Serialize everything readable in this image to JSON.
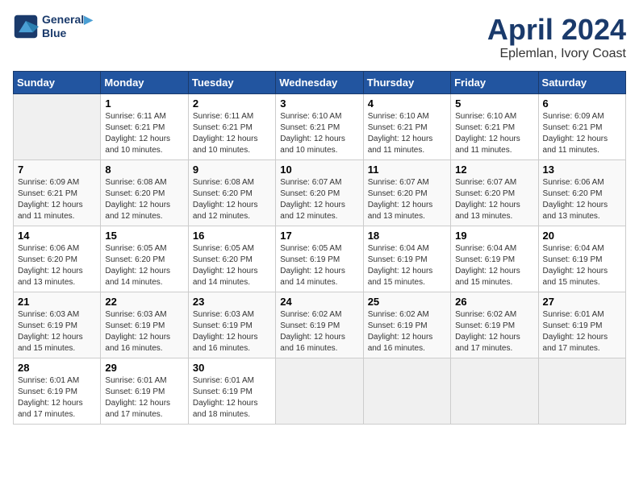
{
  "header": {
    "logo_line1": "General",
    "logo_line2": "Blue",
    "title": "April 2024",
    "subtitle": "Eplemlan, Ivory Coast"
  },
  "calendar": {
    "weekdays": [
      "Sunday",
      "Monday",
      "Tuesday",
      "Wednesday",
      "Thursday",
      "Friday",
      "Saturday"
    ],
    "weeks": [
      [
        {
          "day": "",
          "info": ""
        },
        {
          "day": "1",
          "info": "Sunrise: 6:11 AM\nSunset: 6:21 PM\nDaylight: 12 hours\nand 10 minutes."
        },
        {
          "day": "2",
          "info": "Sunrise: 6:11 AM\nSunset: 6:21 PM\nDaylight: 12 hours\nand 10 minutes."
        },
        {
          "day": "3",
          "info": "Sunrise: 6:10 AM\nSunset: 6:21 PM\nDaylight: 12 hours\nand 10 minutes."
        },
        {
          "day": "4",
          "info": "Sunrise: 6:10 AM\nSunset: 6:21 PM\nDaylight: 12 hours\nand 11 minutes."
        },
        {
          "day": "5",
          "info": "Sunrise: 6:10 AM\nSunset: 6:21 PM\nDaylight: 12 hours\nand 11 minutes."
        },
        {
          "day": "6",
          "info": "Sunrise: 6:09 AM\nSunset: 6:21 PM\nDaylight: 12 hours\nand 11 minutes."
        }
      ],
      [
        {
          "day": "7",
          "info": "Sunrise: 6:09 AM\nSunset: 6:21 PM\nDaylight: 12 hours\nand 11 minutes."
        },
        {
          "day": "8",
          "info": "Sunrise: 6:08 AM\nSunset: 6:20 PM\nDaylight: 12 hours\nand 12 minutes."
        },
        {
          "day": "9",
          "info": "Sunrise: 6:08 AM\nSunset: 6:20 PM\nDaylight: 12 hours\nand 12 minutes."
        },
        {
          "day": "10",
          "info": "Sunrise: 6:07 AM\nSunset: 6:20 PM\nDaylight: 12 hours\nand 12 minutes."
        },
        {
          "day": "11",
          "info": "Sunrise: 6:07 AM\nSunset: 6:20 PM\nDaylight: 12 hours\nand 13 minutes."
        },
        {
          "day": "12",
          "info": "Sunrise: 6:07 AM\nSunset: 6:20 PM\nDaylight: 12 hours\nand 13 minutes."
        },
        {
          "day": "13",
          "info": "Sunrise: 6:06 AM\nSunset: 6:20 PM\nDaylight: 12 hours\nand 13 minutes."
        }
      ],
      [
        {
          "day": "14",
          "info": "Sunrise: 6:06 AM\nSunset: 6:20 PM\nDaylight: 12 hours\nand 13 minutes."
        },
        {
          "day": "15",
          "info": "Sunrise: 6:05 AM\nSunset: 6:20 PM\nDaylight: 12 hours\nand 14 minutes."
        },
        {
          "day": "16",
          "info": "Sunrise: 6:05 AM\nSunset: 6:20 PM\nDaylight: 12 hours\nand 14 minutes."
        },
        {
          "day": "17",
          "info": "Sunrise: 6:05 AM\nSunset: 6:19 PM\nDaylight: 12 hours\nand 14 minutes."
        },
        {
          "day": "18",
          "info": "Sunrise: 6:04 AM\nSunset: 6:19 PM\nDaylight: 12 hours\nand 15 minutes."
        },
        {
          "day": "19",
          "info": "Sunrise: 6:04 AM\nSunset: 6:19 PM\nDaylight: 12 hours\nand 15 minutes."
        },
        {
          "day": "20",
          "info": "Sunrise: 6:04 AM\nSunset: 6:19 PM\nDaylight: 12 hours\nand 15 minutes."
        }
      ],
      [
        {
          "day": "21",
          "info": "Sunrise: 6:03 AM\nSunset: 6:19 PM\nDaylight: 12 hours\nand 15 minutes."
        },
        {
          "day": "22",
          "info": "Sunrise: 6:03 AM\nSunset: 6:19 PM\nDaylight: 12 hours\nand 16 minutes."
        },
        {
          "day": "23",
          "info": "Sunrise: 6:03 AM\nSunset: 6:19 PM\nDaylight: 12 hours\nand 16 minutes."
        },
        {
          "day": "24",
          "info": "Sunrise: 6:02 AM\nSunset: 6:19 PM\nDaylight: 12 hours\nand 16 minutes."
        },
        {
          "day": "25",
          "info": "Sunrise: 6:02 AM\nSunset: 6:19 PM\nDaylight: 12 hours\nand 16 minutes."
        },
        {
          "day": "26",
          "info": "Sunrise: 6:02 AM\nSunset: 6:19 PM\nDaylight: 12 hours\nand 17 minutes."
        },
        {
          "day": "27",
          "info": "Sunrise: 6:01 AM\nSunset: 6:19 PM\nDaylight: 12 hours\nand 17 minutes."
        }
      ],
      [
        {
          "day": "28",
          "info": "Sunrise: 6:01 AM\nSunset: 6:19 PM\nDaylight: 12 hours\nand 17 minutes."
        },
        {
          "day": "29",
          "info": "Sunrise: 6:01 AM\nSunset: 6:19 PM\nDaylight: 12 hours\nand 17 minutes."
        },
        {
          "day": "30",
          "info": "Sunrise: 6:01 AM\nSunset: 6:19 PM\nDaylight: 12 hours\nand 18 minutes."
        },
        {
          "day": "",
          "info": ""
        },
        {
          "day": "",
          "info": ""
        },
        {
          "day": "",
          "info": ""
        },
        {
          "day": "",
          "info": ""
        }
      ]
    ]
  }
}
